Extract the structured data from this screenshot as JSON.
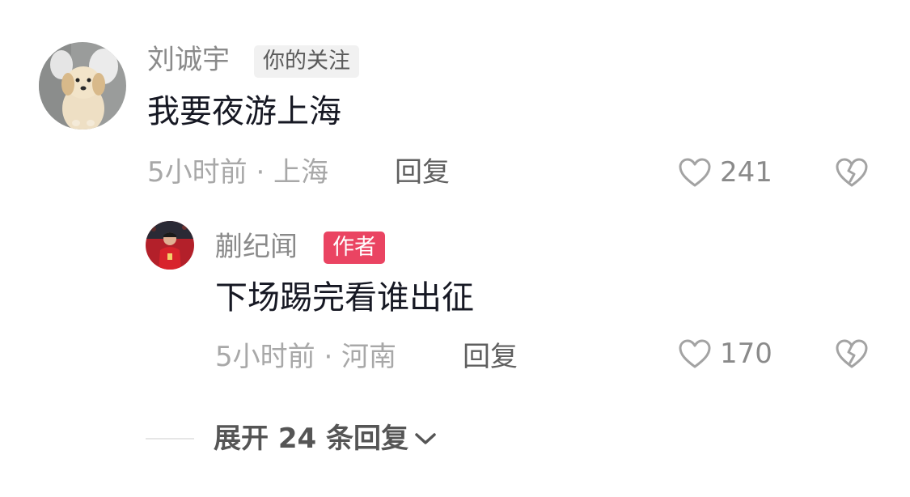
{
  "comments": [
    {
      "username": "刘诚宇",
      "badge": "你的关注",
      "text": "我要夜游上海",
      "meta": "5小时前 · 上海",
      "reply_label": "回复",
      "likes": "241"
    },
    {
      "username": "蒯纪闻",
      "badge": "作者",
      "text": "下场踢完看谁出征",
      "meta": "5小时前 · 河南",
      "reply_label": "回复",
      "likes": "170"
    }
  ],
  "expand_label": "展开 24 条回复",
  "icons": {
    "like": "heart-outline-icon",
    "dislike": "broken-heart-icon",
    "expand": "chevron-down-icon"
  },
  "colors": {
    "author_badge": "#ea4462",
    "follow_badge_bg": "#f1f1f1",
    "text_primary": "#161823",
    "text_secondary": "#8a8a8a"
  }
}
